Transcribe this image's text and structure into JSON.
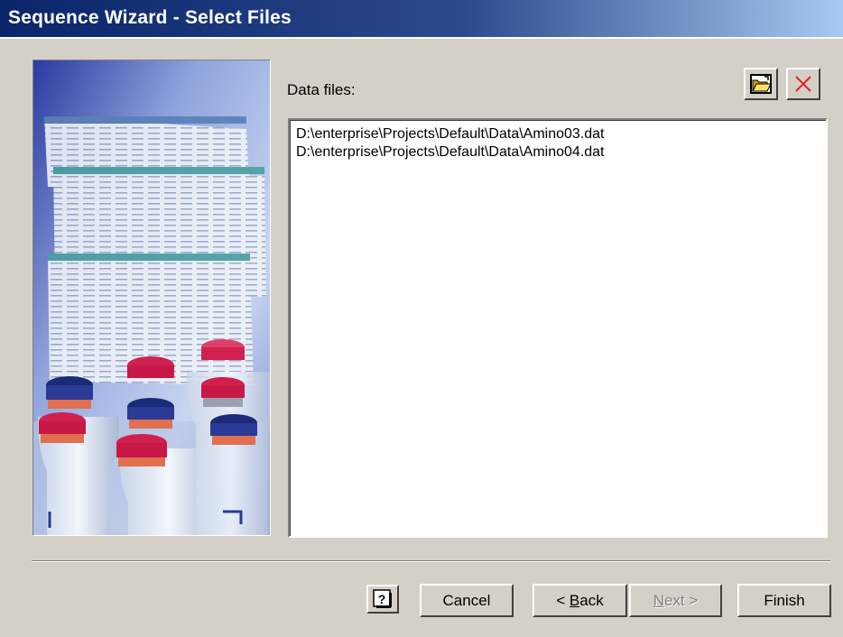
{
  "window": {
    "title": "Sequence Wizard - Select Files"
  },
  "main": {
    "data_files_label": "Data files:",
    "files": [
      "D:\\enterprise\\Projects\\Default\\Data\\Amino03.dat",
      "D:\\enterprise\\Projects\\Default\\Data\\Amino04.dat"
    ]
  },
  "toolbar": {
    "open_icon": "open-folder-icon",
    "delete_icon": "delete-x-icon"
  },
  "buttons": {
    "help_icon": "help-icon",
    "cancel": "Cancel",
    "back_prefix": "< ",
    "back_mnemonic": "B",
    "back_rest": "ack",
    "next_mnemonic": "N",
    "next_rest": "ext >",
    "finish": "Finish"
  },
  "colors": {
    "title_start": "#0a246a",
    "title_end": "#a6caf0",
    "face": "#d4d0c8",
    "delete_red": "#e02020"
  }
}
